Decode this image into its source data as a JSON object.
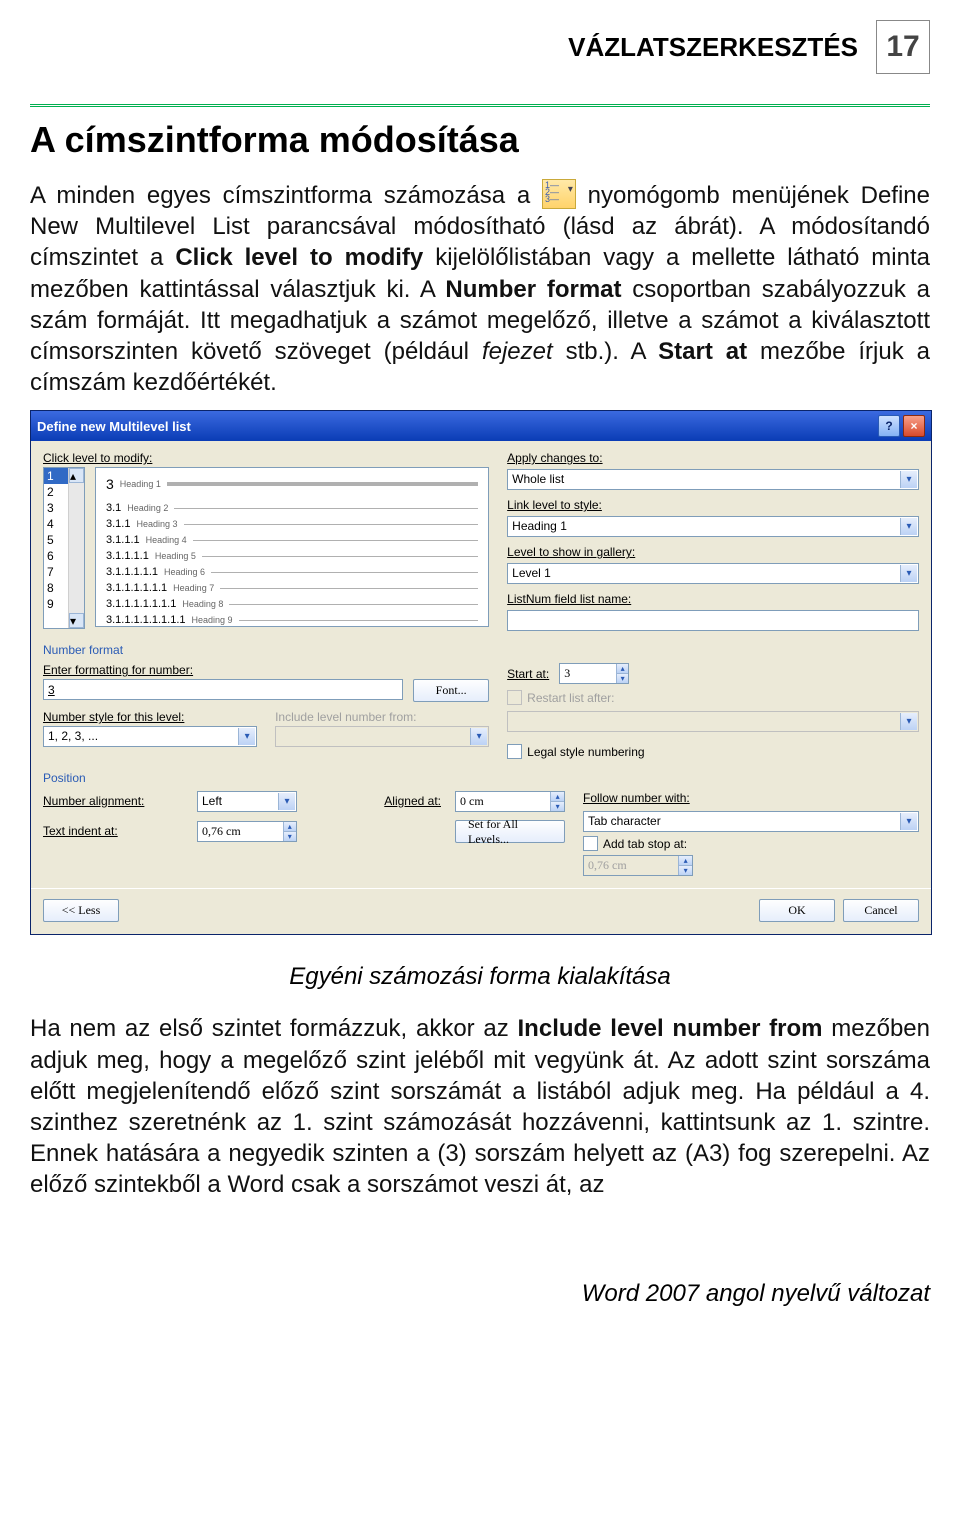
{
  "header": {
    "title": "VÁZLATSZERKESZTÉS",
    "page_number": "17"
  },
  "heading": "A címszintforma módosítása",
  "para1_a": "A minden egyes címszintforma számozása a ",
  "para1_b": " nyomógomb menüjének Define New Multilevel List parancsával módosítható (lásd az ábrát). A módosítandó címszintet a ",
  "para1_c": " kijelölőlistában vagy a mellette látható minta mezőben kattintással választjuk ki. A ",
  "para1_d": " csoportban szabályozzuk a szám formáját. Itt megadhatjuk a számot megelőző, illetve a számot a kiválasztott címsorszinten követő szöveget (például ",
  "para1_e": " stb.). A ",
  "para1_f": " mezőbe írjuk a címszám kezdőértékét.",
  "bold_click": "Click level to modify",
  "bold_number": "Number format",
  "bold_startat": "Start at",
  "italic_fejezet": "fejezet",
  "dialog": {
    "title": "Define new Multilevel list",
    "click_level_label": "Click level to modify:",
    "levels": [
      "1",
      "2",
      "3",
      "4",
      "5",
      "6",
      "7",
      "8",
      "9"
    ],
    "selected_level": "1",
    "preview_rows": [
      {
        "num": "3",
        "lab": "Heading 1",
        "big": true
      },
      {
        "num": "3.1",
        "lab": "Heading 2"
      },
      {
        "num": "3.1.1",
        "lab": "Heading 3"
      },
      {
        "num": "3.1.1.1",
        "lab": "Heading 4"
      },
      {
        "num": "3.1.1.1.1",
        "lab": "Heading 5"
      },
      {
        "num": "3.1.1.1.1.1",
        "lab": "Heading 6"
      },
      {
        "num": "3.1.1.1.1.1.1",
        "lab": "Heading 7"
      },
      {
        "num": "3.1.1.1.1.1.1.1",
        "lab": "Heading 8"
      },
      {
        "num": "3.1.1.1.1.1.1.1.1",
        "lab": "Heading 9"
      }
    ],
    "apply_changes_label": "Apply changes to:",
    "apply_changes_value": "Whole list",
    "link_level_label": "Link level to style:",
    "link_level_value": "Heading 1",
    "level_show_label": "Level to show in gallery:",
    "level_show_value": "Level 1",
    "listnum_label": "ListNum field list name:",
    "listnum_value": "",
    "numberformat_section": "Number format",
    "enter_formatting_label": "Enter formatting for number:",
    "enter_formatting_value": "3",
    "font_button": "Font...",
    "startat_label": "Start at:",
    "startat_value": "3",
    "restart_label": "Restart list after:",
    "restart_value": "",
    "legal_label": "Legal style numbering",
    "numberstyle_label": "Number style for this level:",
    "numberstyle_value": "1, 2, 3, ...",
    "include_label": "Include level number from:",
    "position_section": "Position",
    "numalign_label": "Number alignment:",
    "numalign_value": "Left",
    "aligned_label": "Aligned at:",
    "aligned_value": "0 cm",
    "follow_label": "Follow number with:",
    "follow_value": "Tab character",
    "textindent_label": "Text indent at:",
    "textindent_value": "0,76 cm",
    "setall_button": "Set for All Levels...",
    "addtab_label": "Add tab stop at:",
    "addtab_value": "0,76 cm",
    "less_button": "<< Less",
    "ok_button": "OK",
    "cancel_button": "Cancel"
  },
  "caption": "Egyéni számozási forma kialakítása",
  "para2_a": "Ha nem az első szintet formázzuk, akkor az ",
  "para2_b": " mezőben adjuk meg, hogy a megelőző szint jeléből mit vegyünk át. Az adott szint sorszáma előtt megjelenítendő előző szint sorszámát a listából adjuk meg. Ha például a 4. szinthez szeretnénk az 1. szint számozását hozzávenni, kattintsunk az 1. szintre. Ennek hatására a negyedik szinten a (3) sorszám helyett az (A3) fog szerepelni. Az előző szintekből a Word csak a sorszámot veszi át, az",
  "bold_include": "Include level number from",
  "footer": "Word 2007 angol nyelvű változat"
}
